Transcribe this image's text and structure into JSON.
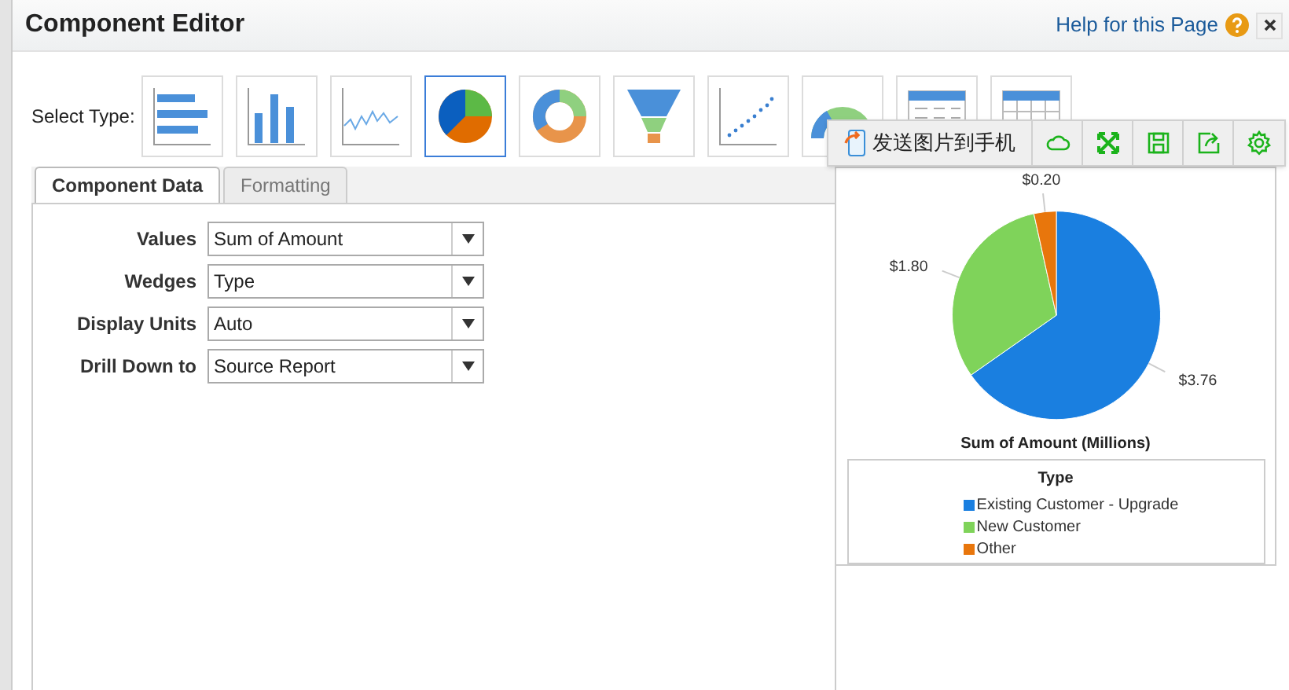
{
  "window": {
    "title": "Component Editor",
    "help_link": "Help for this Page"
  },
  "select_type": {
    "label": "Select Type:",
    "types": [
      {
        "kind": "hbar",
        "selected": false
      },
      {
        "kind": "vbar",
        "selected": false
      },
      {
        "kind": "line",
        "selected": false
      },
      {
        "kind": "pie",
        "selected": true
      },
      {
        "kind": "donut",
        "selected": false
      },
      {
        "kind": "funnel",
        "selected": false
      },
      {
        "kind": "scatter",
        "selected": false
      },
      {
        "kind": "gauge",
        "selected": false
      },
      {
        "kind": "table",
        "selected": false
      },
      {
        "kind": "matrix",
        "selected": false
      }
    ]
  },
  "toolbar": {
    "send_button": "发送图片到手机",
    "icons": [
      {
        "kind": "cloud"
      },
      {
        "kind": "expand"
      },
      {
        "kind": "save"
      },
      {
        "kind": "share"
      },
      {
        "kind": "settings"
      }
    ]
  },
  "tabs": [
    {
      "label": "Component Data",
      "selected": true
    },
    {
      "label": "Formatting",
      "selected": false
    }
  ],
  "fields": [
    {
      "label": "Values",
      "value": "Sum of Amount"
    },
    {
      "label": "Wedges",
      "value": "Type"
    },
    {
      "label": "Display Units",
      "value": "Auto"
    },
    {
      "label": "Drill Down to",
      "value": "Source Report"
    }
  ],
  "chart": {
    "chart_data": {
      "type": "pie",
      "title": "Sum of Amount (Millions)",
      "categories": [
        "Existing Customer - Upgrade",
        "New Customer",
        "Other"
      ],
      "values": [
        3.76,
        1.8,
        0.2
      ],
      "value_labels": [
        "$3.76",
        "$1.80",
        "$0.20"
      ],
      "colors": [
        "#1a7fe0",
        "#7fd35a",
        "#e8760c"
      ]
    },
    "legend": {
      "title": "Type"
    }
  }
}
